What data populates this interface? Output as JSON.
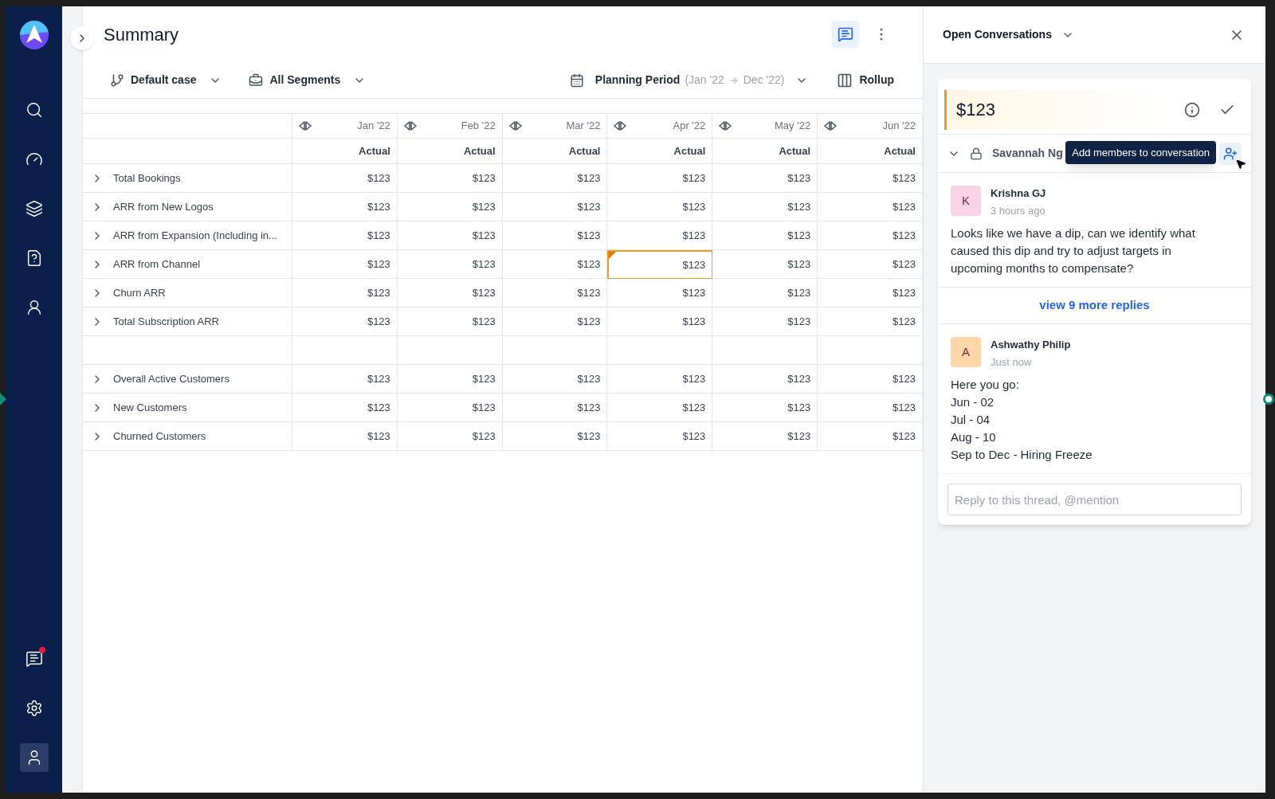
{
  "sidebar": {
    "items": [
      {
        "kind": "search",
        "selected": false,
        "badge": false
      },
      {
        "kind": "gauge",
        "selected": false,
        "badge": false
      },
      {
        "kind": "layers",
        "selected": false,
        "badge": false
      },
      {
        "kind": "help",
        "selected": false,
        "badge": false
      },
      {
        "kind": "person",
        "selected": false,
        "badge": false
      }
    ],
    "bottom_items": [
      {
        "kind": "chat",
        "selected": false,
        "badge": true
      },
      {
        "kind": "settings",
        "selected": false,
        "badge": false
      },
      {
        "kind": "profile",
        "selected": true,
        "badge": false
      }
    ]
  },
  "page": {
    "title": "Summary",
    "comments_open": true
  },
  "toolbar": {
    "scenario": "Default case",
    "segments": "All Segments",
    "period": {
      "label": "Planning Period",
      "start": "(Jan '22",
      "end": "Dec '22)"
    },
    "rollup": "Rollup"
  },
  "table": {
    "columns": [
      {
        "month": "Jan '22",
        "sub": "Actual"
      },
      {
        "month": "Feb '22",
        "sub": "Actual"
      },
      {
        "month": "Mar '22",
        "sub": "Actual"
      },
      {
        "month": "Apr '22",
        "sub": "Actual"
      },
      {
        "month": "May '22",
        "sub": "Actual"
      },
      {
        "month": "Jun '22",
        "sub": "Actual"
      }
    ],
    "rows": [
      {
        "kind": "data",
        "label": "Total Bookings",
        "cells": [
          {
            "text": "$123",
            "selected": false
          },
          {
            "text": "$123",
            "selected": false
          },
          {
            "text": "$123",
            "selected": false
          },
          {
            "text": "$123",
            "selected": false
          },
          {
            "text": "$123",
            "selected": false
          },
          {
            "text": "$123",
            "selected": false
          }
        ]
      },
      {
        "kind": "data",
        "label": "ARR from New Logos",
        "cells": [
          {
            "text": "$123",
            "selected": false
          },
          {
            "text": "$123",
            "selected": false
          },
          {
            "text": "$123",
            "selected": false
          },
          {
            "text": "$123",
            "selected": false
          },
          {
            "text": "$123",
            "selected": false
          },
          {
            "text": "$123",
            "selected": false
          }
        ]
      },
      {
        "kind": "data",
        "label": "ARR from Expansion (Including in...",
        "cells": [
          {
            "text": "$123",
            "selected": false
          },
          {
            "text": "$123",
            "selected": false
          },
          {
            "text": "$123",
            "selected": false
          },
          {
            "text": "$123",
            "selected": false
          },
          {
            "text": "$123",
            "selected": false
          },
          {
            "text": "$123",
            "selected": false
          }
        ]
      },
      {
        "kind": "data",
        "label": "ARR from Channel",
        "cells": [
          {
            "text": "$123",
            "selected": false
          },
          {
            "text": "$123",
            "selected": false
          },
          {
            "text": "$123",
            "selected": false
          },
          {
            "text": "$123",
            "selected": true
          },
          {
            "text": "$123",
            "selected": false
          },
          {
            "text": "$123",
            "selected": false
          }
        ]
      },
      {
        "kind": "data",
        "label": "Churn ARR",
        "cells": [
          {
            "text": "$123",
            "selected": false
          },
          {
            "text": "$123",
            "selected": false
          },
          {
            "text": "$123",
            "selected": false
          },
          {
            "text": "$123",
            "selected": false
          },
          {
            "text": "$123",
            "selected": false
          },
          {
            "text": "$123",
            "selected": false
          }
        ]
      },
      {
        "kind": "data",
        "label": "Total Subscription ARR",
        "cells": [
          {
            "text": "$123",
            "selected": false
          },
          {
            "text": "$123",
            "selected": false
          },
          {
            "text": "$123",
            "selected": false
          },
          {
            "text": "$123",
            "selected": false
          },
          {
            "text": "$123",
            "selected": false
          },
          {
            "text": "$123",
            "selected": false
          }
        ]
      },
      {
        "kind": "spacer"
      },
      {
        "kind": "data",
        "label": "Overall Active Customers",
        "cells": [
          {
            "text": "$123",
            "selected": false
          },
          {
            "text": "$123",
            "selected": false
          },
          {
            "text": "$123",
            "selected": false
          },
          {
            "text": "$123",
            "selected": false
          },
          {
            "text": "$123",
            "selected": false
          },
          {
            "text": "$123",
            "selected": false
          }
        ]
      },
      {
        "kind": "data",
        "label": "New Customers",
        "cells": [
          {
            "text": "$123",
            "selected": false
          },
          {
            "text": "$123",
            "selected": false
          },
          {
            "text": "$123",
            "selected": false
          },
          {
            "text": "$123",
            "selected": false
          },
          {
            "text": "$123",
            "selected": false
          },
          {
            "text": "$123",
            "selected": false
          }
        ]
      },
      {
        "kind": "data",
        "label": "Churned Customers",
        "cells": [
          {
            "text": "$123",
            "selected": false
          },
          {
            "text": "$123",
            "selected": false
          },
          {
            "text": "$123",
            "selected": false
          },
          {
            "text": "$123",
            "selected": false
          },
          {
            "text": "$123",
            "selected": false
          },
          {
            "text": "$123",
            "selected": false
          }
        ]
      }
    ]
  },
  "panel": {
    "title": "Open Conversations",
    "thread": {
      "value": "$123",
      "owner": "Savannah Ng",
      "tooltip": "Add members to conversation",
      "comments": [
        {
          "initial": "K",
          "author": "Krishna GJ",
          "time": "3 hours ago",
          "color": "#f9d4e6",
          "lines": [
            "Looks like we have a dip, can we identify what caused this dip and try to adjust targets in upcoming months to compensate?"
          ]
        }
      ],
      "more_replies": "view 9 more replies",
      "latest": [
        {
          "initial": "A",
          "author": "Ashwathy Philip",
          "time": "Just now",
          "color": "#fdd7a8",
          "lines": [
            "Here you go:",
            "Jun - 02",
            "Jul - 04",
            "Aug - 10",
            "Sep to Dec - Hiring Freeze"
          ]
        }
      ],
      "reply_placeholder": "Reply to this thread, @mention"
    }
  }
}
